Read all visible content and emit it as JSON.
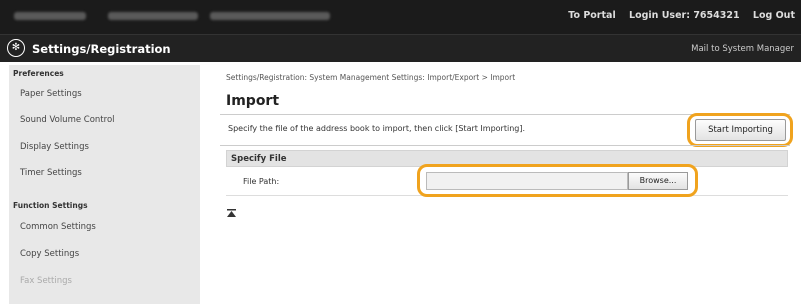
{
  "header": {
    "to_portal": "To Portal",
    "login_user": "Login User: 7654321",
    "log_out": "Log Out",
    "app_title": "Settings/Registration",
    "mail_link": "Mail to System Manager",
    "logo_icon": "gear-settings-icon"
  },
  "sidebar": {
    "preferences": "Preferences",
    "items": [
      {
        "label": "Paper Settings"
      },
      {
        "label": "Sound Volume Control"
      },
      {
        "label": "Display Settings"
      },
      {
        "label": "Timer Settings"
      }
    ],
    "function_settings": "Function Settings",
    "function_items": [
      {
        "label": "Common Settings"
      },
      {
        "label": "Copy Settings"
      },
      {
        "label": "Fax Settings"
      }
    ]
  },
  "main": {
    "breadcrumb": "Settings/Registration: System Management Settings: Import/Export > Import",
    "title": "Import",
    "instruction": "Specify the file of the address book to import, then click [Start Importing].",
    "start_button": "Start Importing",
    "section_title": "Specify File",
    "file_path_label": "File Path:",
    "file_path_value": "",
    "browse_button": "Browse..."
  },
  "colors": {
    "highlight": "#f0a31e",
    "topbar": "#1b1b1b"
  }
}
